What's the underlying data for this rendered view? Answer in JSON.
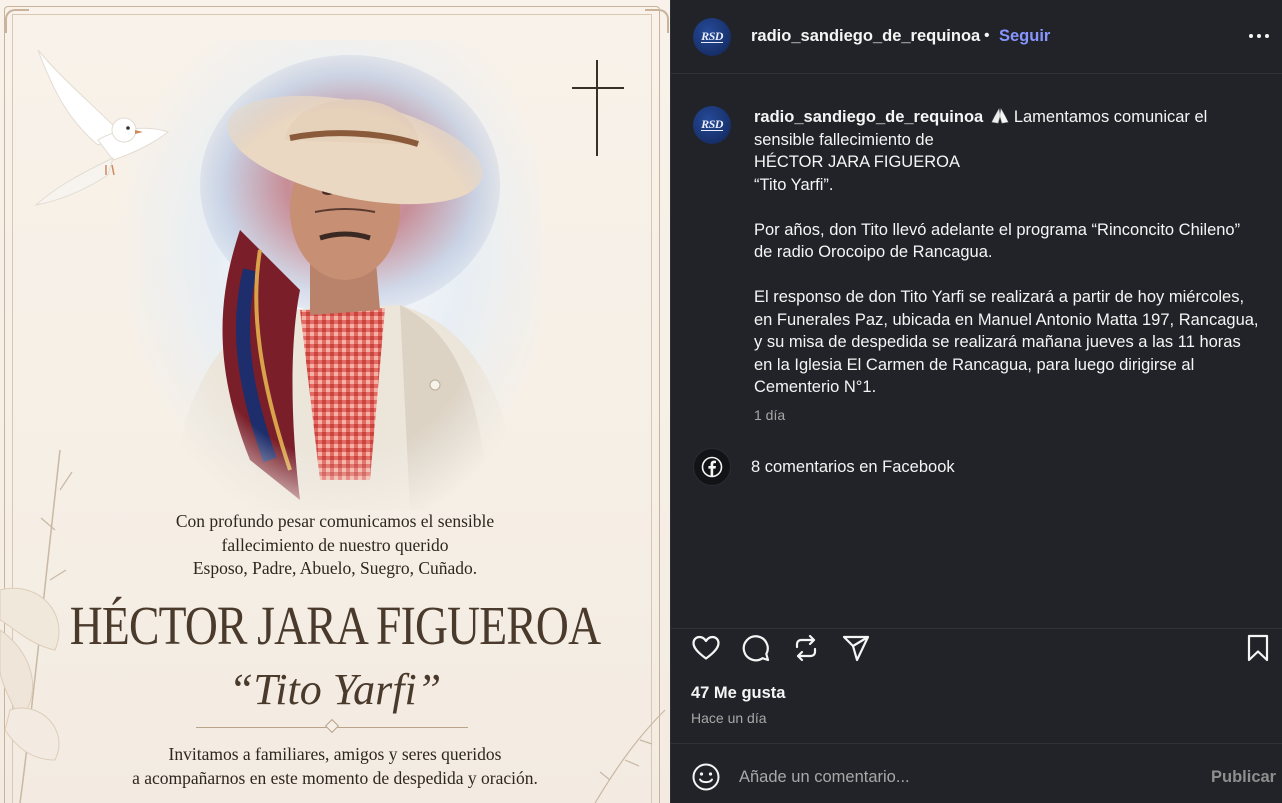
{
  "memorial_card": {
    "intro_lines": [
      "Con profundo pesar comunicamos el sensible",
      "fallecimiento de nuestro querido",
      "Esposo, Padre, Abuelo, Suegro, Cuñado."
    ],
    "name": "HÉCTOR JARA FIGUEROA",
    "nickname": "“Tito Yarfi”",
    "invite_lines": [
      "Invitamos a familiares, amigos y seres queridos",
      "a acompañarnos en este momento de despedida y oración."
    ]
  },
  "post": {
    "account": {
      "username": "radio_sandiego_de_requinoa",
      "avatar_text": "RSD",
      "separator": "•",
      "follow_label": "Seguir"
    },
    "caption": {
      "username": "radio_sandiego_de_requinoa",
      "emoji": "praying-hands-icon",
      "first_line": "Lamentamos comunicar el",
      "lines_a": [
        "sensible fallecimiento de",
        "HÉCTOR JARA FIGUEROA",
        "“Tito Yarfi”."
      ],
      "lines_b": [
        "Por años, don Tito llevó adelante el programa “Rinconcito Chileno”",
        "de radio Orocoipo de Rancagua."
      ],
      "lines_c": [
        "El responso de don Tito Yarfi se realizará a partir de hoy miércoles,",
        "en Funerales Paz, ubicada en Manuel Antonio Matta 197, Rancagua,",
        "y su misa de despedida se realizará mañana jueves a las 11 horas",
        "en la Iglesia El Carmen de Rancagua, para luego dirigirse al",
        "Cementerio N°1."
      ],
      "age": "1 día"
    },
    "facebook_comments": "8 comentarios en Facebook",
    "likes": "47 Me gusta",
    "posted": "Hace un día",
    "comment_placeholder": "Añade un comentario...",
    "publish_label": "Publicar"
  },
  "colors": {
    "panel_bg": "#212328",
    "follow_link": "#8795ff",
    "card_bg": "#f6efe6",
    "name_brown": "#4a3a2c"
  }
}
